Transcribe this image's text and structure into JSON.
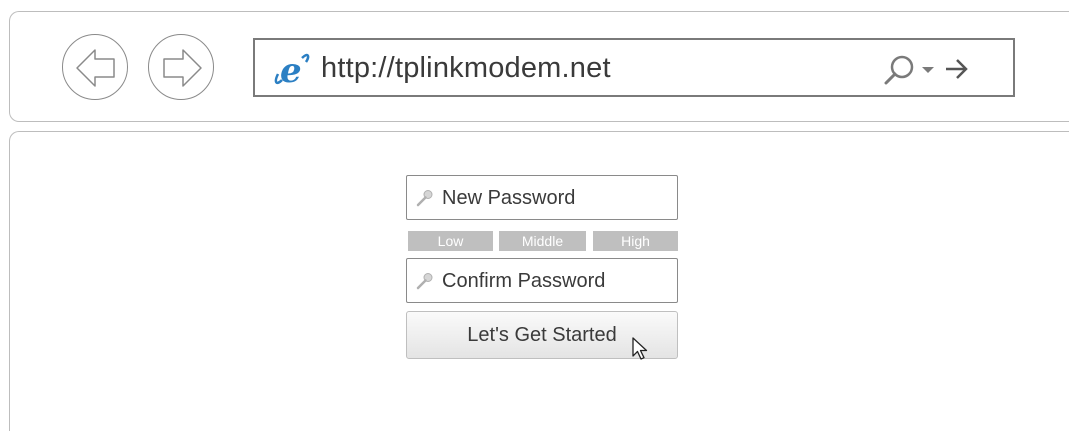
{
  "browser": {
    "url": "http://tplinkmodem.net",
    "icons": {
      "back": "back-arrow-icon",
      "forward": "forward-arrow-icon",
      "browser_logo": "internet-explorer-logo",
      "search": "search-icon",
      "dropdown": "chevron-down-icon",
      "go": "go-arrow-icon"
    }
  },
  "form": {
    "new_password_placeholder": "New Password",
    "confirm_password_placeholder": "Confirm Password",
    "strength_levels": [
      "Low",
      "Middle",
      "High"
    ],
    "submit_label": "Let's Get Started",
    "field_icon": "key-icon"
  },
  "colors": {
    "strength_bar": "#bfbfbf",
    "border": "#8a8a8a",
    "ie_logo": "#2b7fc3"
  }
}
